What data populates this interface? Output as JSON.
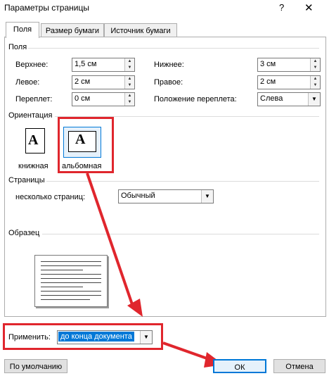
{
  "window": {
    "title": "Параметры страницы",
    "help": "?",
    "close": "✕"
  },
  "tabs": [
    {
      "label": "Поля"
    },
    {
      "label": "Размер бумаги"
    },
    {
      "label": "Источник бумаги"
    }
  ],
  "margins": {
    "group_label": "Поля",
    "top": {
      "label": "Верхнее:",
      "value": "1,5 см"
    },
    "bottom": {
      "label": "Нижнее:",
      "value": "3 см"
    },
    "left": {
      "label": "Левое:",
      "value": "2 см"
    },
    "right": {
      "label": "Правое:",
      "value": "2 см"
    },
    "gutter": {
      "label": "Переплет:",
      "value": "0 см"
    },
    "gutter_pos": {
      "label": "Положение переплета:",
      "value": "Слева"
    }
  },
  "orientation": {
    "group_label": "Ориентация",
    "portrait": "книжная",
    "landscape": "альбомная",
    "glyph": "A"
  },
  "pages": {
    "group_label": "Страницы",
    "multiple_label": "несколько страниц:",
    "multiple_value": "Обычный"
  },
  "preview": {
    "group_label": "Образец"
  },
  "apply": {
    "label": "Применить:",
    "value": "до конца документа"
  },
  "buttons": {
    "default": "По умолчанию",
    "ok": "ОК",
    "cancel": "Отмена"
  },
  "colors": {
    "annotation": "#e0262d",
    "selection": "#0078d7"
  }
}
